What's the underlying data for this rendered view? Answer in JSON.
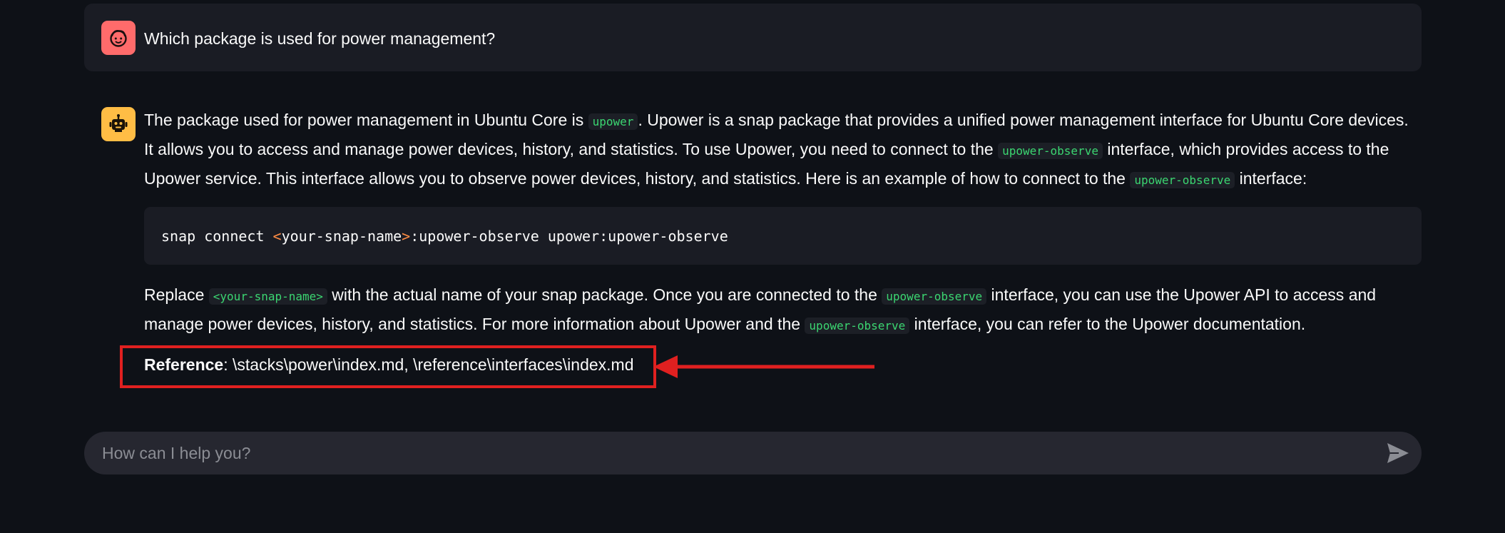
{
  "chat": {
    "user_message": "Which package is used for power management?",
    "assistant": {
      "p1_t1": "The package used for power management in Ubuntu Core is ",
      "p1_c1": "upower",
      "p1_t2": ". Upower is a snap package that provides a unified power management interface for Ubuntu Core devices. It allows you to access and manage power devices, history, and statistics. To use Upower, you need to connect to the ",
      "p1_c2": "upower-observe",
      "p1_t3": " interface, which provides access to the Upower service. This interface allows you to observe power devices, history, and statistics. Here is an example of how to connect to the ",
      "p1_c3": "upower-observe",
      "p1_t4": " interface:",
      "code_cmd": "snap connect ",
      "code_lt": "<",
      "code_arg": "your-snap-name",
      "code_gt": ">",
      "code_rest": ":upower-observe upower:upower-observe",
      "p2_t1": "Replace ",
      "p2_c1": "<your-snap-name>",
      "p2_t2": " with the actual name of your snap package. Once you are connected to the ",
      "p2_c2": "upower-observe",
      "p2_t3": " interface, you can use the Upower API to access and manage power devices, history, and statistics. For more information about Upower and the ",
      "p2_c3": "upower-observe",
      "p2_t4": " interface, you can refer to the Upower documentation.",
      "reference_label": "Reference",
      "reference_text": ": \\stacks\\power\\index.md, \\reference\\interfaces\\index.md"
    }
  },
  "input": {
    "placeholder": "How can I help you?"
  },
  "icons": {
    "user_avatar": "face-icon",
    "bot_avatar": "robot-icon",
    "send": "send-icon",
    "annotation": "arrow-left-icon"
  },
  "colors": {
    "background": "#0e1117",
    "user_avatar": "#ff6b6b",
    "bot_avatar": "#ffbd45",
    "inline_code": "#3bd671",
    "highlight": "#e02020"
  }
}
